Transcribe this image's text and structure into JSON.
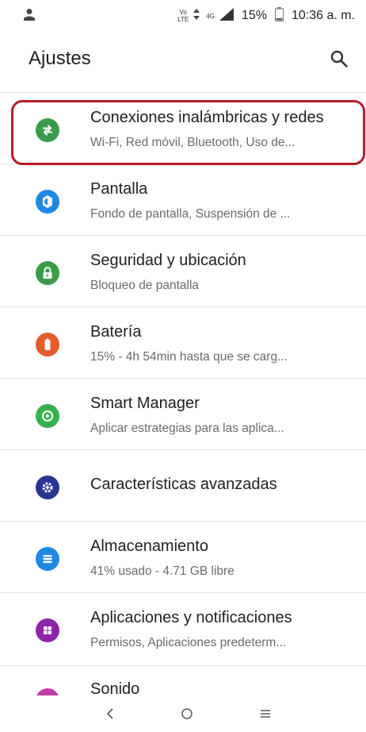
{
  "status_bar": {
    "volte_top": "Vo",
    "volte_bottom": "LTE",
    "network": "4G",
    "battery_percent": "15%",
    "time": "10:36 a. m."
  },
  "header": {
    "title": "Ajustes"
  },
  "settings_items": [
    {
      "title": "Conexiones inalámbricas y redes",
      "subtitle": "Wi-Fi, Red móvil, Bluetooth, Uso de...",
      "icon": "connections-icon",
      "color": "#3a9c4b"
    },
    {
      "title": "Pantalla",
      "subtitle": "Fondo de pantalla, Suspensión de ...",
      "icon": "brightness-icon",
      "color": "#1e88e5"
    },
    {
      "title": "Seguridad y ubicación",
      "subtitle": "Bloqueo de pantalla",
      "icon": "lock-icon",
      "color": "#3a9c4b"
    },
    {
      "title": "Batería",
      "subtitle": "15% - 4h 54min hasta que se carg...",
      "icon": "battery-icon",
      "color": "#e65a2b"
    },
    {
      "title": "Smart Manager",
      "subtitle": "Aplicar estrategias para las aplica...",
      "icon": "smart-manager-icon",
      "color": "#35b34a"
    },
    {
      "title": "Características avanzadas",
      "subtitle": "",
      "icon": "gear-plus-icon",
      "color": "#283593"
    },
    {
      "title": "Almacenamiento",
      "subtitle": "41% usado - 4.71 GB libre",
      "icon": "storage-icon",
      "color": "#1e88e5"
    },
    {
      "title": "Aplicaciones y notificaciones",
      "subtitle": "Permisos, Aplicaciones predeterm...",
      "icon": "apps-icon",
      "color": "#8e24aa"
    }
  ],
  "partial_item": {
    "title": "Sonido",
    "color": "#c23ba7"
  },
  "nav": {
    "back": "‹",
    "home": "○",
    "recents": "≡"
  }
}
